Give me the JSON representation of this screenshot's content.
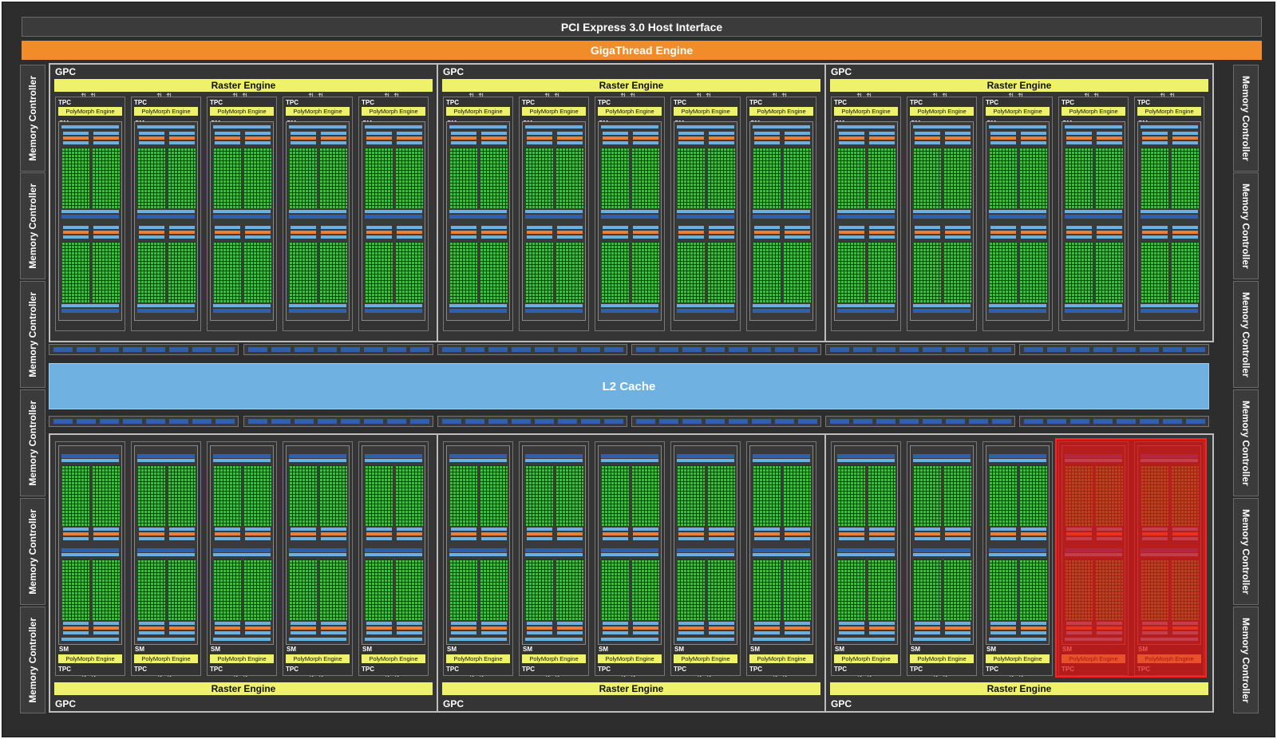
{
  "host_interface": "PCI Express 3.0 Host Interface",
  "gigathread": "GigaThread Engine",
  "l2_cache": "L2 Cache",
  "memory_controller_label": "Memory Controller",
  "memory_controllers_per_side": 6,
  "gpc": {
    "label": "GPC",
    "raster_label": "Raster Engine",
    "tpc_label": "TPC",
    "sm_label": "SM",
    "polymorph_label": "PolyMorph Engine",
    "tpcs_per_gpc": 5,
    "rows": 2,
    "cols": 3
  },
  "disabled_tpc": {
    "gpc_row": 2,
    "gpc_col": 3,
    "tpc_index": 4
  },
  "colors": {
    "background": "#2d2d2d",
    "gigathread": "#f08c2a",
    "raster": "#eef16a",
    "l2": "#6fb1e0",
    "core": "#35c635",
    "disabled": "#e61414"
  }
}
